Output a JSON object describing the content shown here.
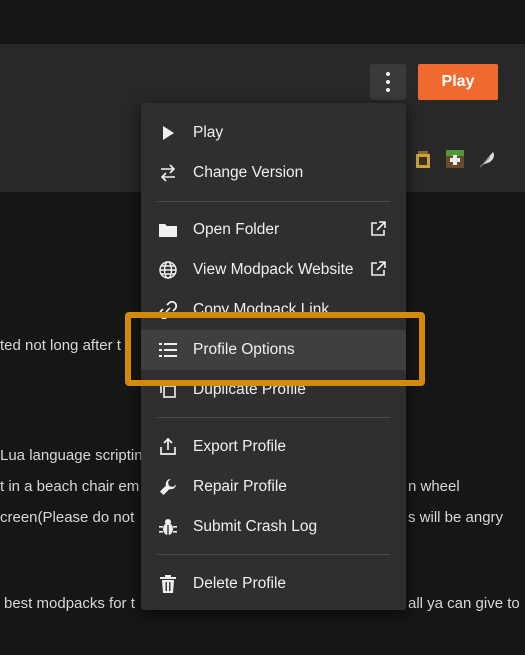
{
  "header": {
    "play_label": "Play",
    "kebab_icon": "more-vertical-icon",
    "accent_color": "#f06a2f"
  },
  "background_text": {
    "line1": "ted not long after t",
    "line2": "Lua language scriptin",
    "line3": "t in a beach chair em",
    "line3_right": "n wheel",
    "line4": "creen(Please do not",
    "line4_right": "s will be angry",
    "line5": "best modpacks for t",
    "line5_right": "all ya can give to"
  },
  "menu": {
    "items": [
      {
        "label": "Play",
        "icon": "play-icon"
      },
      {
        "label": "Change Version",
        "icon": "swap-arrows-icon"
      },
      {
        "label": "Open Folder",
        "icon": "folder-icon",
        "external": true
      },
      {
        "label": "View Modpack Website",
        "icon": "globe-icon",
        "external": true
      },
      {
        "label": "Copy Modpack Link",
        "icon": "link-icon"
      },
      {
        "label": "Profile Options",
        "icon": "list-icon"
      },
      {
        "label": "Duplicate Profile",
        "icon": "copy-icon"
      },
      {
        "label": "Export Profile",
        "icon": "upload-icon"
      },
      {
        "label": "Repair Profile",
        "icon": "wrench-icon"
      },
      {
        "label": "Submit Crash Log",
        "icon": "bug-icon"
      },
      {
        "label": "Delete Profile",
        "icon": "trash-icon"
      }
    ],
    "highlight_color": "#d48a06"
  }
}
